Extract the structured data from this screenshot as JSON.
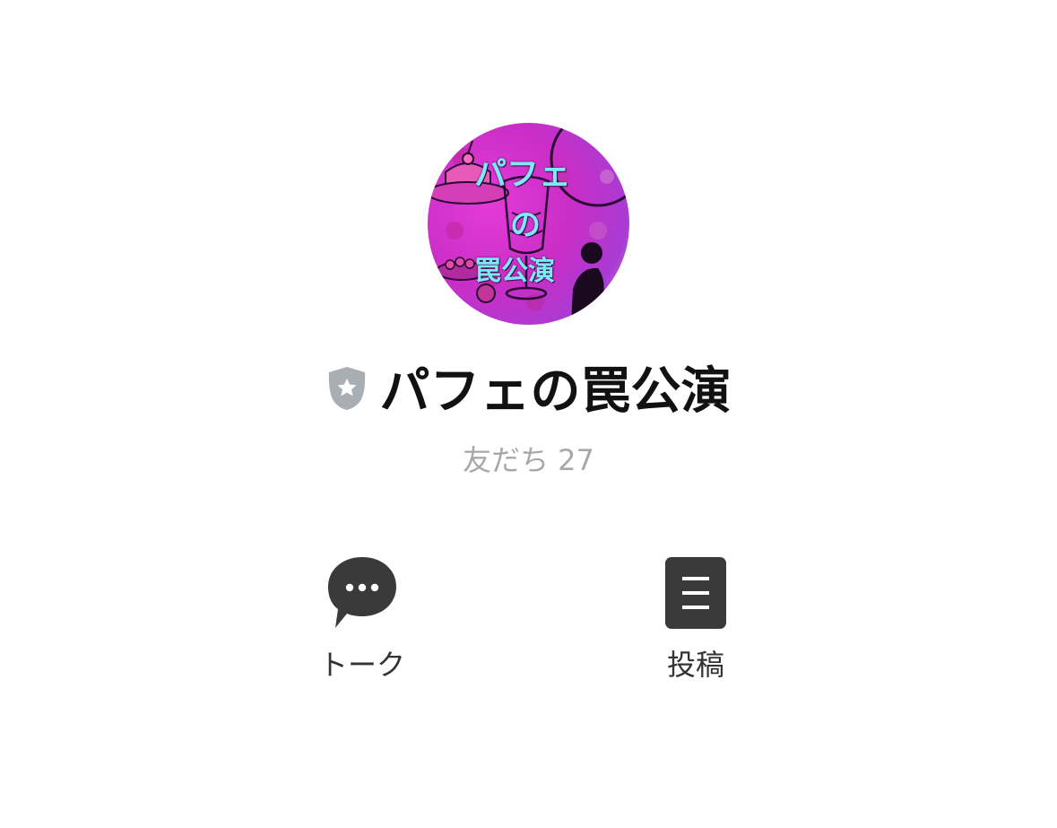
{
  "profile": {
    "avatar_text_line1": "パフェ",
    "avatar_text_line2": "の",
    "avatar_text_line3": "罠公演",
    "name": "パフェの罠公演",
    "friends_label": "友だち",
    "friends_count": "27"
  },
  "actions": {
    "talk_label": "トーク",
    "post_label": "投稿"
  },
  "icons": {
    "badge": "shield-star-icon",
    "talk": "chat-bubble-icon",
    "post": "document-icon"
  },
  "colors": {
    "title": "#111111",
    "friends": "#a8a8a8",
    "icon_dark": "#3a3a3a",
    "badge_gray": "#a9adb4",
    "avatar_magenta": "#d636cf",
    "avatar_text": "#7ee9f2"
  }
}
